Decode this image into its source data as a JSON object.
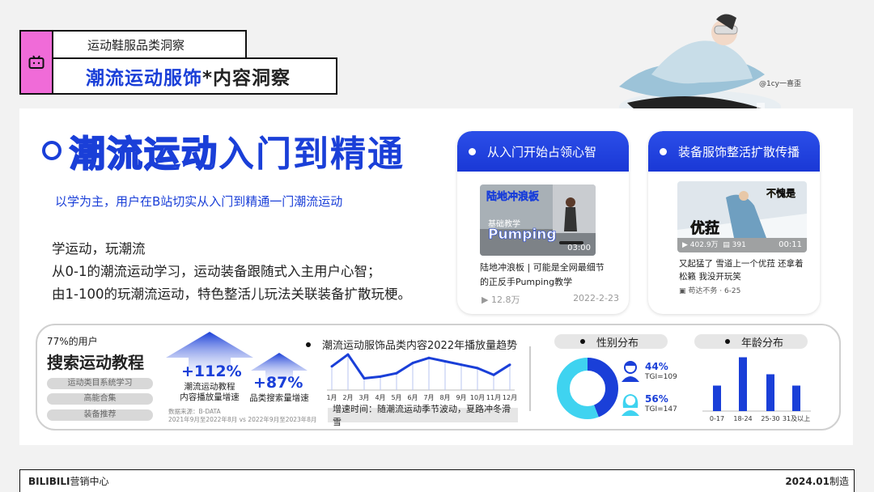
{
  "header": {
    "category": "运动鞋服品类洞察",
    "title_blue": "潮流运动服饰",
    "title_rest": "*内容洞察"
  },
  "hero": {
    "credit": "@1cy一喜歪"
  },
  "main": {
    "headline_outline": "潮流运动",
    "headline_solid": "入门到精通",
    "subtitle": "以学为主，用户在B站切实从入门到精通一门潮流运动",
    "lines": [
      "学运动，玩潮流",
      "从0-1的潮流运动学习，运动装备跟随式入主用户心智；",
      "由1-100的玩潮流运动，特色整活儿玩法关联装备扩散玩梗。"
    ]
  },
  "cards": [
    {
      "head": "从入门开始占领心智",
      "thumb_top": "陆地冲浪板",
      "thumb_mid": "基础教学",
      "thumb_big": "Pumping",
      "duration": "03:00",
      "title": "陆地冲浪板 | 可能是全网最细节的正反手Pumping教学",
      "views": "12.8万",
      "date": "2022-2-23"
    },
    {
      "head": "装备服饰整活扩散传播",
      "thumb_big": "优菈",
      "thumb_tag": "不愧是",
      "views": "402.9万",
      "comments": "391",
      "duration": "00:11",
      "title": "又起猛了 雪道上一个优菈 还拿着松籁 我没开玩笑",
      "author": "苟达不务 · 6-25"
    }
  ],
  "search": {
    "pct": "77%的用户",
    "title": "搜索运动教程",
    "pills": [
      "运动类目系统学习",
      "高能合集",
      "装备推荐"
    ],
    "growth1": "+112%",
    "growth1_label_1": "潮流运动教程",
    "growth1_label_2": "内容播放量增速",
    "growth2": "+87%",
    "growth2_label": "品类搜索量增速",
    "source_1": "数据来源：B-DATA",
    "source_2": "2021年9月至2022年8月 vs 2022年9月至2023年8月"
  },
  "trend": {
    "title": "潮流运动服饰品类内容2022年播放量趋势",
    "note": "增速时间：随潮流运动季节波动，夏路冲冬滑雪"
  },
  "gender": {
    "title": "性别分布",
    "male_pct": "44%",
    "male_tgi": "TGI=109",
    "female_pct": "56%",
    "female_tgi": "TGI=147"
  },
  "age": {
    "title": "年龄分布"
  },
  "chart_data": [
    {
      "type": "line",
      "title": "潮流运动服饰品类内容2022年播放量趋势",
      "categories": [
        "1月",
        "2月",
        "3月",
        "4月",
        "5月",
        "6月",
        "7月",
        "8月",
        "9月",
        "10月",
        "11月",
        "12月"
      ],
      "values": [
        60,
        95,
        25,
        30,
        40,
        70,
        85,
        75,
        65,
        55,
        35,
        65
      ],
      "ylim": [
        0,
        100
      ]
    },
    {
      "type": "pie",
      "title": "性别分布",
      "categories": [
        "男",
        "女"
      ],
      "values": [
        44,
        56
      ],
      "colors": [
        "#1a3fd8",
        "#3fd3f0"
      ]
    },
    {
      "type": "bar",
      "title": "年龄分布",
      "categories": [
        "0-17",
        "18-24",
        "25-30",
        "31及以上"
      ],
      "values": [
        45,
        95,
        65,
        45
      ],
      "ylim": [
        0,
        100
      ]
    }
  ],
  "footer": {
    "left_bold": "BILIBILI",
    "left_rest": "营销中心",
    "right_bold": "2024.01",
    "right_rest": "制造"
  },
  "colors": {
    "brand_blue": "#1a3fd8",
    "cyan": "#3fd3f0",
    "pink": "#f06bd8"
  }
}
